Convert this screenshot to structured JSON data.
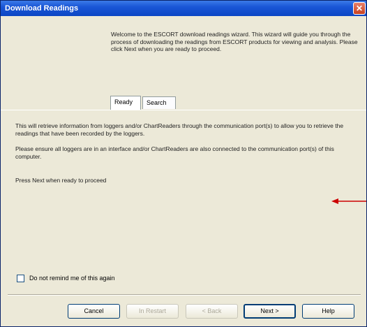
{
  "window": {
    "title": "Download Readings",
    "close_glyph": "✕"
  },
  "header": {
    "intro": "Welcome to the ESCORT download readings wizard. This wizard will guide you through the process of downloading the readings from ESCORT products for viewing and analysis. Please click Next when you are ready to proceed."
  },
  "tabs": [
    {
      "label": "Ready",
      "active": true
    },
    {
      "label": "Search",
      "active": false
    }
  ],
  "body": {
    "p1": "This will retrieve information from loggers and/or ChartReaders through the communication port(s) to allow you to retrieve the readings that have been recorded by the loggers.",
    "p2": "Please ensure all loggers are in an interface and/or ChartReaders are also connected to the communication port(s) of this computer.",
    "p3": "Press Next when ready to proceed"
  },
  "checkbox": {
    "label": "Do not remind me of this again",
    "checked": false
  },
  "buttons": {
    "cancel": "Cancel",
    "restart": "In Restart",
    "back": "< Back",
    "next": "Next >",
    "help": "Help"
  },
  "colors": {
    "annotation_arrow": "#cc0000"
  }
}
